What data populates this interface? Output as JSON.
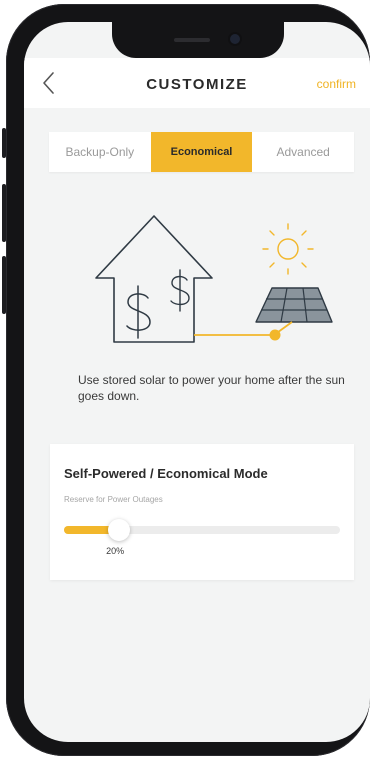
{
  "header": {
    "title": "CUSTOMIZE",
    "confirm_label": "confirm",
    "back_icon": "chevron-left-icon"
  },
  "tabs": [
    {
      "label": "Backup-Only",
      "active": false
    },
    {
      "label": "Economical",
      "active": true
    },
    {
      "label": "Advanced",
      "active": false
    }
  ],
  "illustration": {
    "icons": [
      "house-icon",
      "dollar-icon",
      "dollar-icon",
      "sun-icon",
      "solar-panel-icon"
    ],
    "line_color": "#2f3a44",
    "accent_color": "#f2b72b",
    "panel_color": "#8a949c"
  },
  "description": "Use stored solar to power your home after the sun goes down.",
  "mode_card": {
    "title": "Self-Powered / Economical Mode",
    "subtitle": "Reserve for Power Outages",
    "reserve_percent": 20,
    "reserve_label": "20%"
  },
  "colors": {
    "accent": "#f2b72b",
    "confirm": "#f0b323",
    "background": "#f3f4f4",
    "text": "#2b2b2b"
  }
}
